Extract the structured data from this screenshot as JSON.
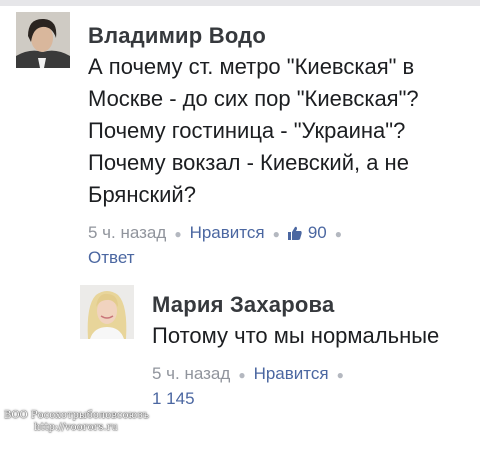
{
  "comments": [
    {
      "author": "Владимир Водо",
      "text": "А почему ст. метро \"Киевская\" в Москве - до сих пор \"Киевская\"? Почему гостиница - \"Украина\"? Почему вокзал - Киевский, а не Брянский?",
      "time": "5 ч. назад",
      "like_label": "Нравится",
      "like_count": "90",
      "reply_label": "Ответ"
    },
    {
      "author": "Мария Захарова",
      "text": "Потому что мы нормальные",
      "time": "5 ч. назад",
      "like_label": "Нравится",
      "like_count": "1 145"
    }
  ],
  "watermark": {
    "line1": "ВОО Росохотрыболовсоюзъ",
    "line2": "http://voorors.ru"
  }
}
